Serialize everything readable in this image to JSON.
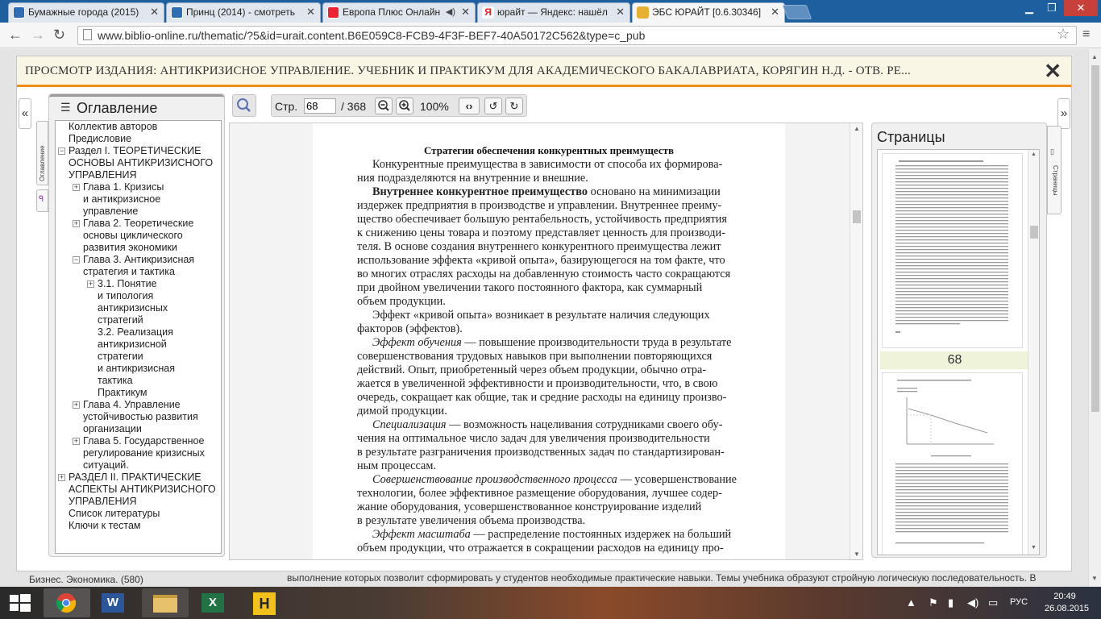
{
  "browser": {
    "tabs": [
      {
        "title": "Бумажные города (2015)",
        "active": false
      },
      {
        "title": "Принц (2014) - смотреть",
        "active": false
      },
      {
        "title": "Европа Плюс Онлайн",
        "active": false
      },
      {
        "title": "юрайт — Яндекс: нашёл",
        "active": false
      },
      {
        "title": "ЭБС ЮРАЙТ [0.6.30346]",
        "active": true
      }
    ],
    "url": "www.biblio-online.ru/thematic/?5&id=urait.content.B6E059C8-FCB9-4F3F-BEF7-40A50172C562&type=c_pub"
  },
  "background_page": {
    "left_text": "Бизнес. Экономика. (580)",
    "right_text": "выполнение которых позволит сформировать у студентов необходимые практические навыки. Темы учебника образуют стройную логическую последовательность. В"
  },
  "viewer": {
    "title": "ПРОСМОТР ИЗДАНИЯ: АНТИКРИЗИСНОЕ УПРАВЛЕНИЕ. УЧЕБНИК И ПРАКТИКУМ ДЛЯ АКАДЕМИЧЕСКОГО БАКАЛАВРИАТА, КОРЯГИН Н.Д. - ОТВ. РЕ...",
    "close": "✕",
    "collapse_left": "«",
    "collapse_right": "»",
    "side_tab_toc": "Оглавление",
    "side_tab_pages": "Страницы",
    "toc": {
      "heading": "Оглавление",
      "lines": [
        "Коллектив авторов",
        "Предисловие",
        "Раздел I. ТЕОРЕТИЧЕСКИЕ",
        "ОСНОВЫ АНТИКРИЗИСНОГО",
        "УПРАВЛЕНИЯ",
        "Глава 1. Кризисы",
        "и антикризисное",
        "управление",
        "Глава 2. Теоретические",
        "основы циклического",
        "развития экономики",
        "Глава 3. Антикризисная",
        "стратегия и тактика",
        "3.1. Понятие",
        "и типология",
        "антикризисных",
        "стратегий",
        "3.2. Реализация",
        "антикризисной",
        "стратегии",
        "и антикризисная",
        "тактика",
        "Практикум",
        "Глава 4. Управление",
        "устойчивостью развития",
        "организации",
        "Глава 5. Государственное",
        "регулирование кризисных",
        "ситуаций.",
        "РАЗДЕЛ II. ПРАКТИЧЕСКИЕ",
        "АСПЕКТЫ АНТИКРИЗИСНОГО",
        "УПРАВЛЕНИЯ",
        "Список литературы",
        "Ключи к тестам"
      ]
    },
    "toolbar": {
      "page_label": "Стр.",
      "page_value": "68",
      "page_total": "/ 368",
      "zoom": "100%"
    },
    "document": {
      "heading": "Стратегии обеспечения конкурентных преимуществ",
      "lines": [
        {
          "indent": true,
          "text": "Конкурентные преимущества в зависимости от способа их формирова-"
        },
        {
          "indent": false,
          "text": "ния подразделяются на внутренние и внешние."
        },
        {
          "indent": true,
          "bold": "Внутреннее конкурентное преимущество",
          "text": " основано на минимизации"
        },
        {
          "indent": false,
          "text": "издержек предприятия в производстве и управлении. Внутреннее преиму-"
        },
        {
          "indent": false,
          "text": "щество обеспечивает большую рентабельность, устойчивость предприятия"
        },
        {
          "indent": false,
          "text": "к снижению цены товара и поэтому представляет ценность для производи-"
        },
        {
          "indent": false,
          "text": "теля. В основе создания внутреннего конкурентного преимущества лежит"
        },
        {
          "indent": false,
          "text": "использование эффекта «кривой опыта», базирующегося на том факте, что"
        },
        {
          "indent": false,
          "text": "во многих отраслях расходы на добавленную стоимость часто сокращаются"
        },
        {
          "indent": false,
          "text": "при двойном увеличении такого постоянного фактора, как суммарный"
        },
        {
          "indent": false,
          "text": "объем продукции."
        },
        {
          "indent": true,
          "text": "Эффект «кривой опыта» возникает в результате наличия следующих"
        },
        {
          "indent": false,
          "text": "факторов (эффектов)."
        },
        {
          "indent": true,
          "italic": "Эффект обучения",
          "text": " — повышение производительности труда в результате"
        },
        {
          "indent": false,
          "text": "совершенствования трудовых навыков при выполнении повторяющихся"
        },
        {
          "indent": false,
          "text": "действий. Опыт, приобретенный через объем продукции, обычно отра-"
        },
        {
          "indent": false,
          "text": "жается в увеличенной эффективности и производительности, что, в свою"
        },
        {
          "indent": false,
          "text": "очередь, сокращает как общие, так и средние расходы на единицу произво-"
        },
        {
          "indent": false,
          "text": "димой продукции."
        },
        {
          "indent": true,
          "italic": "Специализация",
          "text": " — возможность нацеливания сотрудниками своего обу-"
        },
        {
          "indent": false,
          "text": "чения на оптимальное число задач для увеличения производительности"
        },
        {
          "indent": false,
          "text": "в результате разграничения производственных задач по стандартизирован-"
        },
        {
          "indent": false,
          "text": "ным процессам."
        },
        {
          "indent": true,
          "italic": "Совершенствование производственного процесса",
          "text": " — усовершенствование"
        },
        {
          "indent": false,
          "text": "технологии, более эффективное размещение оборудования, лучшее содер-"
        },
        {
          "indent": false,
          "text": "жание оборудования, усовершенствованное конструирование изделий"
        },
        {
          "indent": false,
          "text": "в результате увеличения объема производства."
        },
        {
          "indent": true,
          "italic": "Эффект масштаба",
          "text": " — распределение постоянных издержек на больший"
        },
        {
          "indent": false,
          "text": "объем продукции, что отражается в сокращении расходов на единицу про-"
        }
      ]
    },
    "pages_panel": {
      "heading": "Страницы",
      "current_page": "68"
    }
  },
  "taskbar": {
    "lang": "РУС",
    "time": "20:49",
    "date": "26.08.2015"
  },
  "colors": {
    "accent": "#f28c18",
    "tabbar": "#1e5fa0"
  }
}
